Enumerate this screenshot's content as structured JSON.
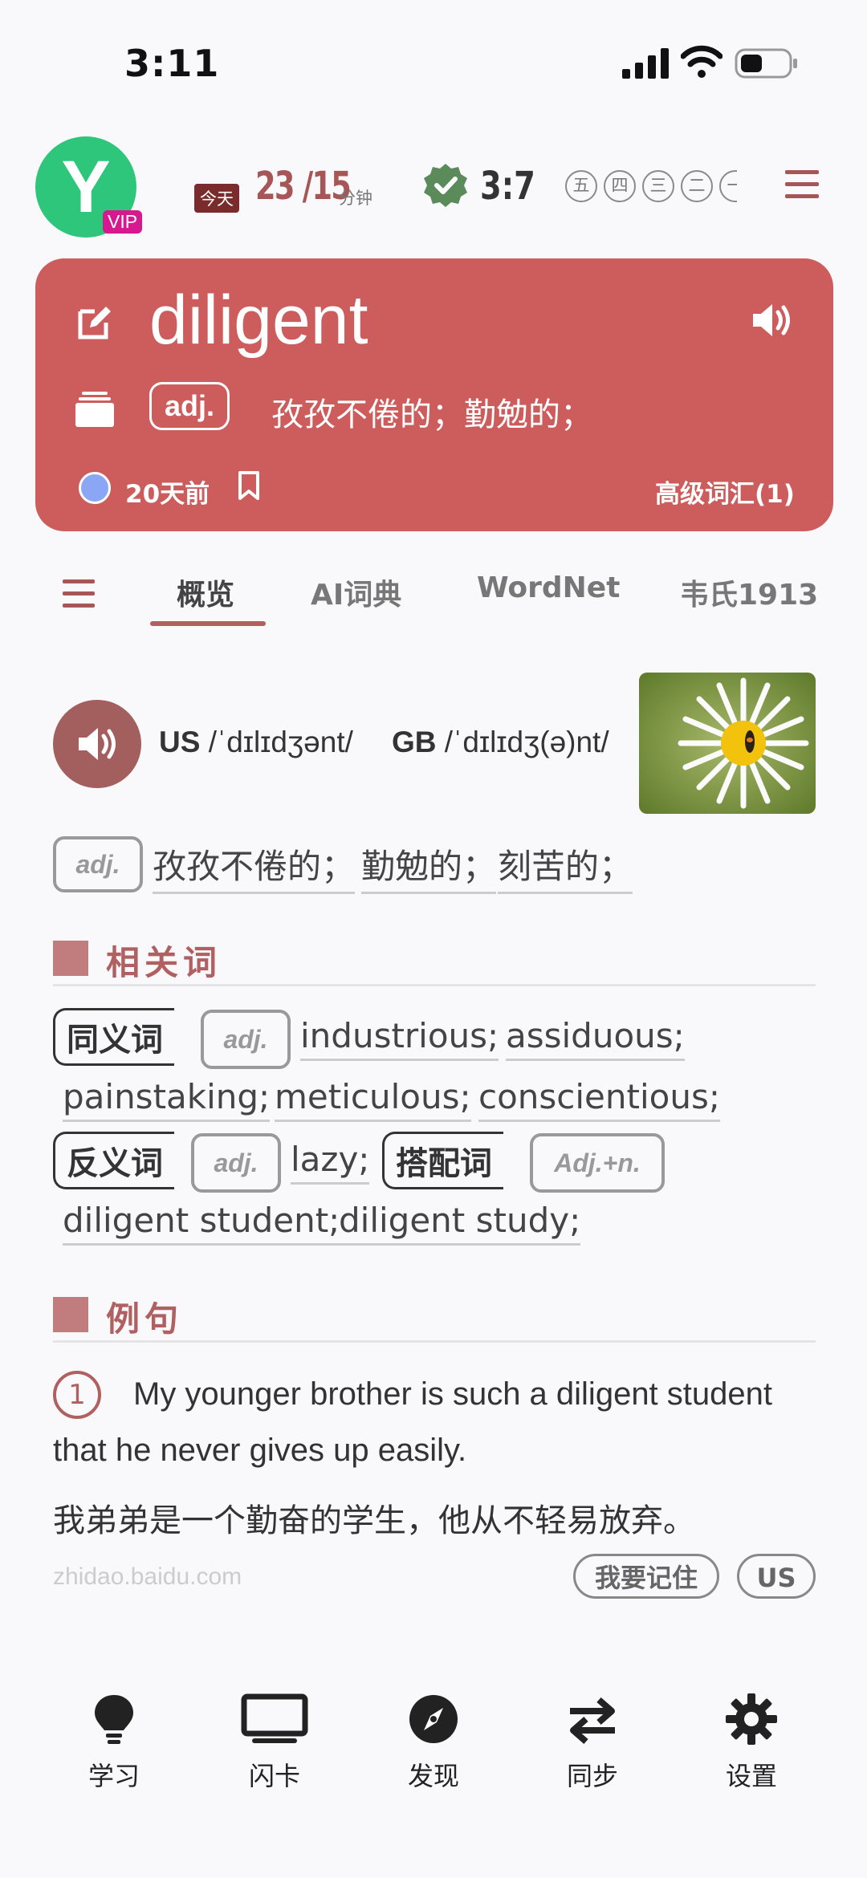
{
  "status_bar": {
    "time": "3:11"
  },
  "header": {
    "avatar_letter": "Y",
    "vip_label": "VIP",
    "today_label": "今天",
    "progress": "23 /15",
    "progress_unit": "分钟",
    "ratio": "3:7",
    "weekdays": [
      "五",
      "四",
      "三",
      "二",
      "一"
    ]
  },
  "word_card": {
    "word": "diligent",
    "pos": "adj.",
    "definition": "孜孜不倦的；勤勉的；",
    "time_ago": "20天前",
    "level": "高级词汇(1)",
    "accent_color": "#cd5c5c"
  },
  "tabs": [
    {
      "label": "概览",
      "active": true
    },
    {
      "label": "AI词典",
      "active": false
    },
    {
      "label": "WordNet",
      "active": false
    },
    {
      "label": "韦氏1913",
      "active": false
    }
  ],
  "pronunciation": {
    "us_label": "US",
    "us_ipa": "/ˈdɪlɪdʒənt/",
    "gb_label": "GB",
    "gb_ipa": "/ˈdɪlɪdʒ(ə)nt/"
  },
  "definition": {
    "pos": "adj.",
    "meanings": [
      "孜孜不倦的；",
      "勤勉的；",
      "刻苦的；"
    ]
  },
  "related": {
    "title": "相关词",
    "synonym_label": "同义词",
    "synonym_pos": "adj.",
    "synonyms": [
      "industrious;",
      "assiduous;",
      "painstaking;",
      "meticulous;",
      "conscientious;"
    ],
    "antonym_label": "反义词",
    "antonym_pos": "adj.",
    "antonyms": [
      "lazy;"
    ],
    "collocation_label": "搭配词",
    "collocation_pos": "Adj.+n.",
    "collocations": [
      "diligent student;",
      "diligent study;"
    ]
  },
  "examples": {
    "title": "例句",
    "items": [
      {
        "num": "1",
        "en": "My younger brother is such a diligent student that he never gives up easily.",
        "zh": "我弟弟是一个勤奋的学生，他从不轻易放弃。",
        "source": "zhidao.baidu.com",
        "remember_label": "我要记住",
        "accent_label": "US"
      }
    ]
  },
  "bottom_nav": [
    {
      "label": "学习",
      "icon": "lightbulb-icon"
    },
    {
      "label": "闪卡",
      "icon": "monitor-icon"
    },
    {
      "label": "发现",
      "icon": "compass-icon"
    },
    {
      "label": "同步",
      "icon": "sync-arrows-icon"
    },
    {
      "label": "设置",
      "icon": "gear-icon"
    }
  ]
}
